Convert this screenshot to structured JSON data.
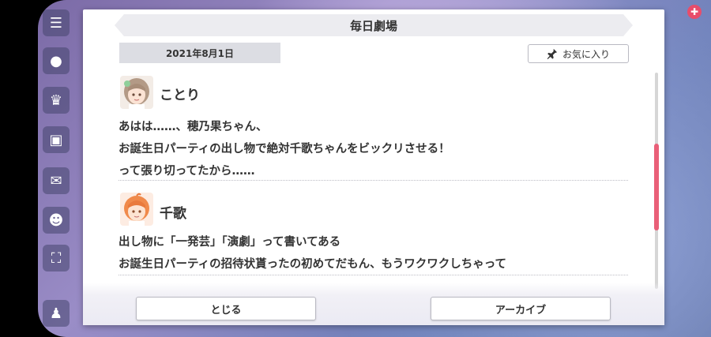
{
  "dialog": {
    "title": "毎日劇場",
    "date": "2021年8月1日",
    "favorite_label": "お気に入り",
    "close_label": "とじる",
    "archive_label": "アーカイブ"
  },
  "entries": [
    {
      "speaker": "ことり",
      "lines": [
        "あはは……、穂乃果ちゃん、",
        "お誕生日パーティの出し物で絶対千歌ちゃんをビックリさせる！",
        "って張り切ってたから……"
      ]
    },
    {
      "speaker": "千歌",
      "lines": [
        "出し物に「一発芸」「演劇」って書いてある",
        "お誕生日パーティの招待状貰ったの初めてだもん、もうワクワクしちゃって"
      ]
    }
  ],
  "colors": {
    "accent": "#e95f78",
    "title_bg": "#ececf0",
    "date_bg": "#dcdde3",
    "text": "#333333"
  },
  "icons": {
    "favorite": "pin-icon",
    "menu": "menu-icon"
  }
}
